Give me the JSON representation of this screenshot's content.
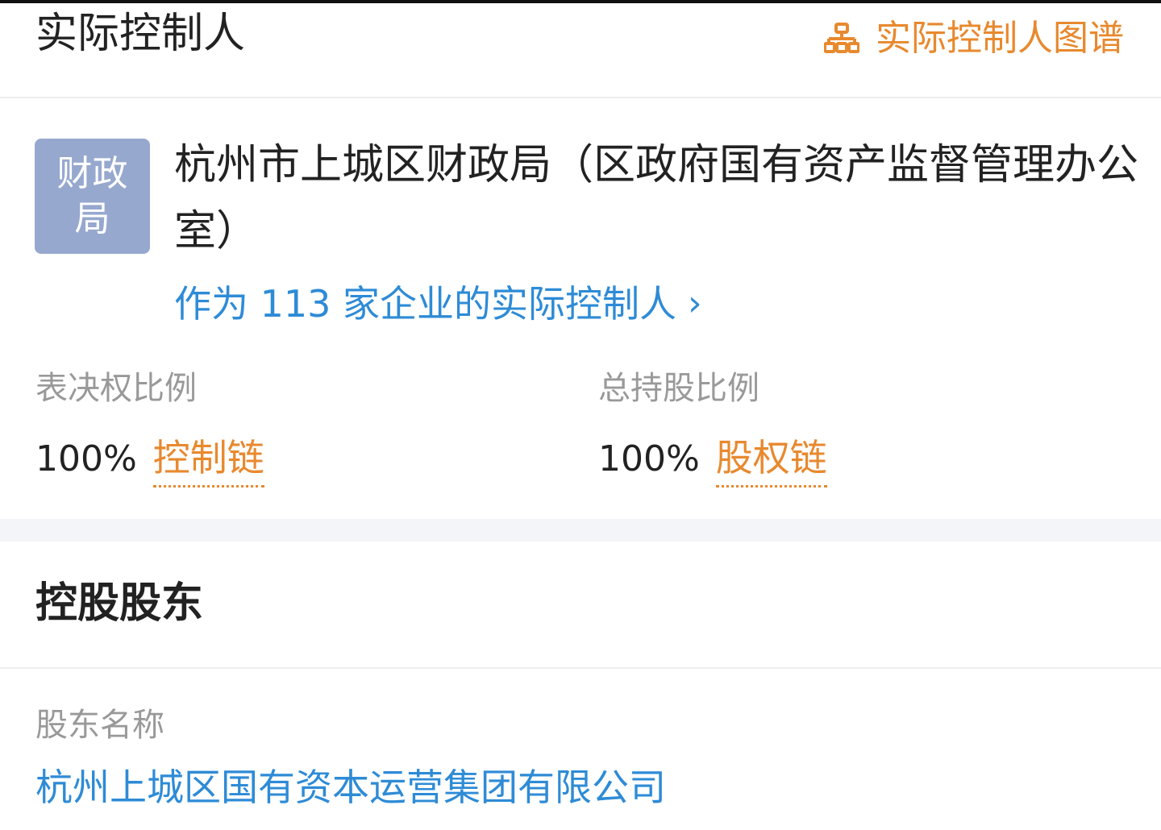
{
  "header": {
    "title": "实际控制人",
    "graph_link": "实际控制人图谱",
    "graph_icon": "org-chart-icon",
    "accent_color": "#e8892e"
  },
  "controller": {
    "logo_text": "财政局",
    "logo_color": "#97a8cf",
    "name": "杭州市上城区财政局（区政府国有资产监督管理办公室）",
    "controls_link": "作为 113 家企业的实际控制人",
    "link_icon": "chevron-right-icon",
    "link_color": "#2e8bd6",
    "voting": {
      "label": "表决权比例",
      "value": "100%",
      "link": "控制链"
    },
    "holding": {
      "label": "总持股比例",
      "value": "100%",
      "link": "股权链"
    }
  },
  "controlling_shareholder": {
    "title": "控股股东",
    "column_label": "股东名称",
    "name": "杭州上城区国有资本运营集团有限公司"
  }
}
